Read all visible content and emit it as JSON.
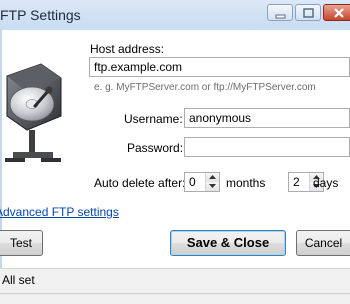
{
  "window": {
    "title": "FTP Settings",
    "buttons": [
      "minimize-icon",
      "maximize-icon",
      "close-icon"
    ]
  },
  "form": {
    "host": {
      "label": "Host address:",
      "value": "ftp.example.com",
      "hint": "e. g. MyFTPServer.com or ftp://MyFTPServer.com"
    },
    "username": {
      "label": "Username:",
      "value": "anonymous"
    },
    "password": {
      "label": "Password:",
      "value": ""
    },
    "auto_delete": {
      "label": "Auto delete after:",
      "months_value": "0",
      "months_label": "months",
      "days_value": "2",
      "days_label": "days"
    }
  },
  "links": {
    "advanced": "Advanced FTP settings"
  },
  "buttons": {
    "test": "Test",
    "save_close": "Save & Close",
    "cancel": "Cancel"
  },
  "status": {
    "text": "All set"
  },
  "colors": {
    "link": "#0645ad",
    "primary_border": "#3c7fb1",
    "titlebar": "#dbe8f6"
  }
}
